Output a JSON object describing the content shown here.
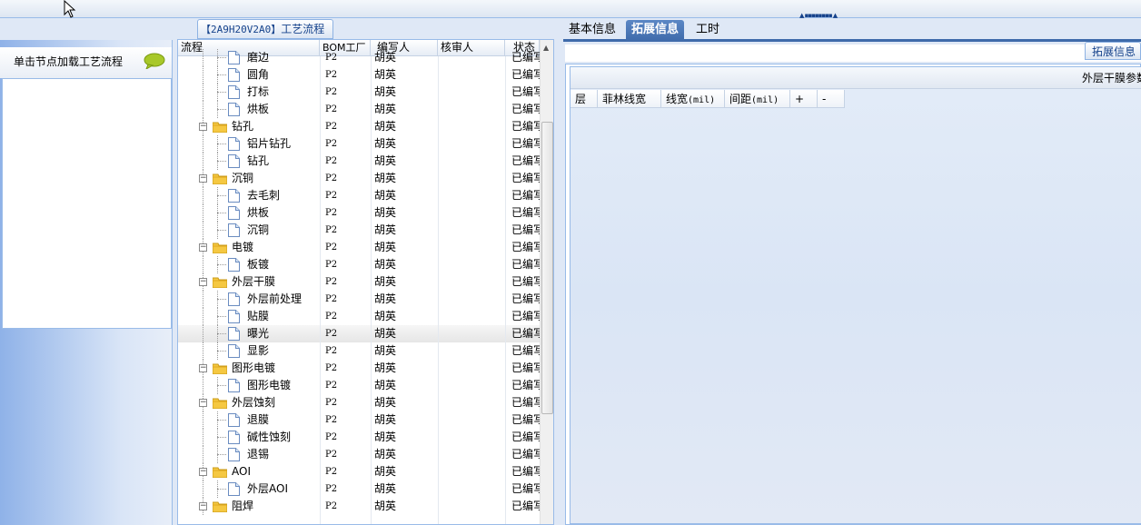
{
  "flow_tab": {
    "code": "【2A9H20V2A0】",
    "label": "工艺流程"
  },
  "left_panel": {
    "header": "单击节点加载工艺流程"
  },
  "tree": {
    "columns": {
      "flow": "流程",
      "bom_factory": "BOM工厂",
      "author": "编写人",
      "reviewer": "核审人",
      "status": "状态"
    },
    "rows": [
      {
        "level": 2,
        "type": "doc",
        "name": "磨边",
        "bom": "P2",
        "author": "胡英",
        "status": "已编写"
      },
      {
        "level": 2,
        "type": "doc",
        "name": "圆角",
        "bom": "P2",
        "author": "胡英",
        "status": "已编写"
      },
      {
        "level": 2,
        "type": "doc",
        "name": "打标",
        "bom": "P2",
        "author": "胡英",
        "status": "已编写"
      },
      {
        "level": 2,
        "type": "doc",
        "name": "烘板",
        "bom": "P2",
        "author": "胡英",
        "status": "已编写"
      },
      {
        "level": 1,
        "type": "folder",
        "name": "钻孔",
        "bom": "P2",
        "author": "胡英",
        "status": "已编写"
      },
      {
        "level": 2,
        "type": "doc",
        "name": "铝片钻孔",
        "bom": "P2",
        "author": "胡英",
        "status": "已编写"
      },
      {
        "level": 2,
        "type": "doc",
        "name": "钻孔",
        "bom": "P2",
        "author": "胡英",
        "status": "已编写"
      },
      {
        "level": 1,
        "type": "folder",
        "name": "沉铜",
        "bom": "P2",
        "author": "胡英",
        "status": "已编写"
      },
      {
        "level": 2,
        "type": "doc",
        "name": "去毛刺",
        "bom": "P2",
        "author": "胡英",
        "status": "已编写"
      },
      {
        "level": 2,
        "type": "doc",
        "name": "烘板",
        "bom": "P2",
        "author": "胡英",
        "status": "已编写"
      },
      {
        "level": 2,
        "type": "doc",
        "name": "沉铜",
        "bom": "P2",
        "author": "胡英",
        "status": "已编写"
      },
      {
        "level": 1,
        "type": "folder",
        "name": "电镀",
        "bom": "P2",
        "author": "胡英",
        "status": "已编写"
      },
      {
        "level": 2,
        "type": "doc",
        "name": "板镀",
        "bom": "P2",
        "author": "胡英",
        "status": "已编写"
      },
      {
        "level": 1,
        "type": "folder",
        "name": "外层干膜",
        "bom": "P2",
        "author": "胡英",
        "status": "已编写"
      },
      {
        "level": 2,
        "type": "doc",
        "name": "外层前处理",
        "bom": "P2",
        "author": "胡英",
        "status": "已编写"
      },
      {
        "level": 2,
        "type": "doc",
        "name": "贴膜",
        "bom": "P2",
        "author": "胡英",
        "status": "已编写"
      },
      {
        "level": 2,
        "type": "doc",
        "name": "曝光",
        "bom": "P2",
        "author": "胡英",
        "status": "已编写",
        "selected": true
      },
      {
        "level": 2,
        "type": "doc",
        "name": "显影",
        "bom": "P2",
        "author": "胡英",
        "status": "已编写"
      },
      {
        "level": 1,
        "type": "folder",
        "name": "图形电镀",
        "bom": "P2",
        "author": "胡英",
        "status": "已编写"
      },
      {
        "level": 2,
        "type": "doc",
        "name": "图形电镀",
        "bom": "P2",
        "author": "胡英",
        "status": "已编写"
      },
      {
        "level": 1,
        "type": "folder",
        "name": "外层蚀刻",
        "bom": "P2",
        "author": "胡英",
        "status": "已编写"
      },
      {
        "level": 2,
        "type": "doc",
        "name": "退膜",
        "bom": "P2",
        "author": "胡英",
        "status": "已编写"
      },
      {
        "level": 2,
        "type": "doc",
        "name": "碱性蚀刻",
        "bom": "P2",
        "author": "胡英",
        "status": "已编写"
      },
      {
        "level": 2,
        "type": "doc",
        "name": "退锡",
        "bom": "P2",
        "author": "胡英",
        "status": "已编写"
      },
      {
        "level": 1,
        "type": "folder",
        "name": "AOI",
        "bom": "P2",
        "author": "胡英",
        "status": "已编写"
      },
      {
        "level": 2,
        "type": "doc",
        "name": "外层AOI",
        "bom": "P2",
        "author": "胡英",
        "status": "已编写"
      },
      {
        "level": 1,
        "type": "folder",
        "name": "阻焊",
        "bom": "P2",
        "author": "胡英",
        "status": "已编写"
      }
    ]
  },
  "right_panel": {
    "tabs": [
      {
        "label": "基本信息",
        "active": false
      },
      {
        "label": "拓展信息",
        "active": true
      },
      {
        "label": "工时",
        "active": false
      }
    ],
    "subtab": "拓展信息",
    "section_title": "外层干膜参数",
    "grid_columns": {
      "layer": "层",
      "philips_line_width": "菲林线宽",
      "line_width": "线宽",
      "line_width_unit": "(mil)",
      "spacing": "间距",
      "spacing_unit": "(mil)",
      "add": "+",
      "remove": "-"
    }
  },
  "colors": {
    "accent": "#3e6aaa",
    "border": "#99bbe8",
    "panel_bg": "#dfe8f6"
  }
}
